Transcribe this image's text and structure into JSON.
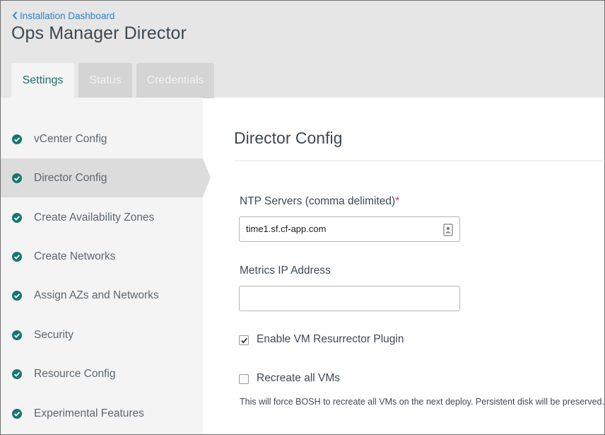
{
  "header": {
    "back_link": "Installation Dashboard",
    "title": "Ops Manager Director",
    "tabs": [
      {
        "label": "Settings",
        "active": true
      },
      {
        "label": "Status",
        "active": false
      },
      {
        "label": "Credentials",
        "active": false
      }
    ]
  },
  "sidebar": {
    "items": [
      {
        "label": "vCenter Config",
        "icon": "check-circle-icon",
        "selected": false
      },
      {
        "label": "Director Config",
        "icon": "check-circle-icon",
        "selected": true
      },
      {
        "label": "Create Availability Zones",
        "icon": "check-circle-icon",
        "selected": false
      },
      {
        "label": "Create Networks",
        "icon": "check-circle-icon",
        "selected": false
      },
      {
        "label": "Assign AZs and Networks",
        "icon": "check-circle-icon",
        "selected": false
      },
      {
        "label": "Security",
        "icon": "check-circle-icon",
        "selected": false
      },
      {
        "label": "Resource Config",
        "icon": "check-circle-icon",
        "selected": false
      },
      {
        "label": "Experimental Features",
        "icon": "check-circle-icon",
        "selected": false
      }
    ]
  },
  "main": {
    "title": "Director Config",
    "ntp": {
      "label": "NTP Servers (comma delimited)",
      "required_marker": "*",
      "value": "time1.sf.cf-app.com"
    },
    "metrics": {
      "label": "Metrics IP Address",
      "value": ""
    },
    "resurrector": {
      "label": "Enable VM Resurrector Plugin",
      "checked": true
    },
    "recreate": {
      "label": "Recreate all VMs",
      "checked": false,
      "help": "This will force BOSH to recreate all VMs on the next deploy. Persistent disk will be preserved."
    }
  },
  "colors": {
    "accent_teal": "#1f6f6b",
    "check_icon": "#16776f",
    "link_blue": "#2d82c9",
    "required_red": "#d0393d",
    "header_bg": "#e6e6e6",
    "sidebar_bg": "#f4f4f4",
    "sidebar_selected_bg": "#dcdcdc"
  }
}
